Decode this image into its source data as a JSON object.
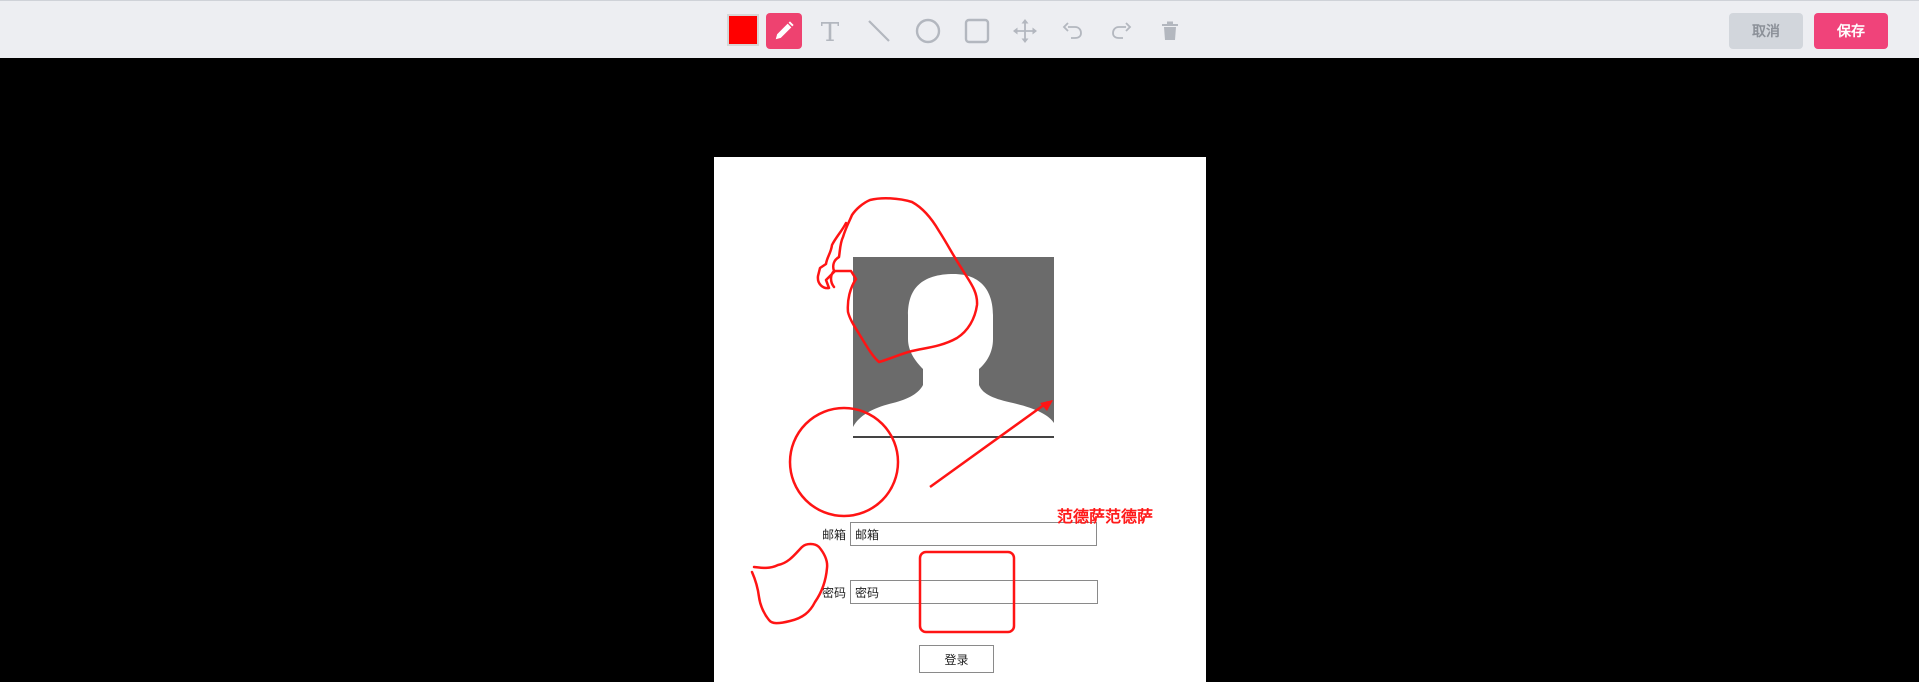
{
  "toolbar": {
    "current_color": "#ff0000",
    "tools": [
      {
        "name": "pencil-tool",
        "icon": "pencil-icon",
        "active": true
      },
      {
        "name": "text-tool",
        "icon": "text-t-icon"
      },
      {
        "name": "line-tool",
        "icon": "line-icon"
      },
      {
        "name": "circle-tool",
        "icon": "circle-icon"
      },
      {
        "name": "rectangle-tool",
        "icon": "rectangle-icon"
      },
      {
        "name": "move-tool",
        "icon": "move-arrows-icon"
      },
      {
        "name": "undo-tool",
        "icon": "undo-icon"
      },
      {
        "name": "redo-tool",
        "icon": "redo-icon"
      },
      {
        "name": "delete-tool",
        "icon": "trash-icon"
      }
    ],
    "cancel_label": "取消",
    "save_label": "保存"
  },
  "page": {
    "email_label": "邮箱",
    "email_value": "邮箱",
    "password_label": "密码",
    "password_value": "密码",
    "login_label": "登录",
    "avatar_icon": "user-silhouette-icon"
  },
  "annotations": {
    "text": "范德萨范德萨",
    "color": "#ff1a1a"
  }
}
